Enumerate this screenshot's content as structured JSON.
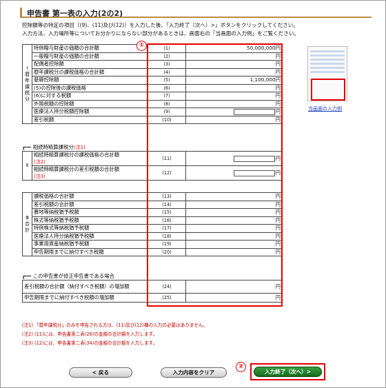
{
  "header": {
    "title": "申告書 第一表の入力(2の2)"
  },
  "instructions": [
    "控除額等の特定の項目（(9)、(11)及び(12)）を入力した後、「入力終了（次へ）>」ボタンをクリックしてください。",
    "入力方法、入力場所等についてお分かりにならない部分があるときは、画面右の「当画面の入力例」をご覧ください。"
  ],
  "annotations": {
    "marker1": "①",
    "marker2": "②"
  },
  "section1": {
    "category": [
      "Ⅰ",
      "暦",
      "年",
      "課",
      "税",
      "分"
    ],
    "rows": [
      {
        "label": "特例贈与財産の価額の合計額",
        "num": "(1)",
        "value": "50,000,000",
        "unit": "円",
        "input": false
      },
      {
        "label": "一般贈与財産の価額の合計額",
        "num": "(2)",
        "value": "",
        "unit": "円",
        "input": false
      },
      {
        "label": "配偶者控除額",
        "num": "(3)",
        "value": "",
        "unit": "円",
        "input": false
      },
      {
        "label": "暦年課税分の課税価格の合計額",
        "num": "(4)",
        "value": "",
        "unit": "円",
        "input": false
      },
      {
        "label": "基礎控除額",
        "num": "(5)",
        "value": "1,100,000",
        "unit": "円",
        "input": false
      },
      {
        "label": "(5)の控除後の課税価格",
        "num": "(6)",
        "value": "",
        "unit": "円",
        "input": false
      },
      {
        "label": "(6)に対する税額",
        "num": "(7)",
        "value": "",
        "unit": "円",
        "input": false
      },
      {
        "label": "外国税額の控除額",
        "num": "(8)",
        "value": "",
        "unit": "円",
        "input": false
      },
      {
        "label": "医療法人持分税額控除額",
        "num": "(9)",
        "value": "",
        "unit": "円",
        "input": true
      },
      {
        "label": "差引税額",
        "num": "(10)",
        "value": "",
        "unit": "円",
        "input": false
      }
    ]
  },
  "section2": {
    "heading": "相続時精算課税分",
    "heading_note": "(注1)",
    "category": "Ⅱ",
    "rows": [
      {
        "label": "相続時精算課税分の課税価格の合計額",
        "note": "(注2)",
        "num": "(11)",
        "unit": "円"
      },
      {
        "label": "相続時精算課税分の差引税額の合計額",
        "note": "(注3)",
        "num": "(12)",
        "unit": "円"
      }
    ]
  },
  "section3": {
    "category": [
      "Ⅲ",
      "合",
      "計"
    ],
    "rows": [
      {
        "label": "課税価格の合計額",
        "num": "(13)",
        "unit": "円"
      },
      {
        "label": "差引税額の合計額",
        "num": "(14)",
        "unit": "円"
      },
      {
        "label": "農地等納税猶予税額",
        "num": "(15)",
        "unit": "円"
      },
      {
        "label": "株式等納税猶予税額",
        "num": "(16)",
        "unit": "円"
      },
      {
        "label": "特例株式等納税猶予税額",
        "num": "(17)",
        "unit": "円"
      },
      {
        "label": "医療法人持分納税猶予税額",
        "num": "(18)",
        "unit": "円"
      },
      {
        "label": "事業用資産納税猶予税額",
        "num": "(19)",
        "unit": "円"
      },
      {
        "label": "申告期限までに納付すべき税額",
        "num": "(20)",
        "unit": "円"
      }
    ]
  },
  "section4": {
    "heading": "この申告書が修正申告書である場合",
    "rows": [
      {
        "label": "差引税額の合計額（納付すべき税額）の増加額",
        "num": "(24)",
        "unit": "円"
      },
      {
        "label": "申告期限までに納付すべき税額の増加額",
        "num": "(25)",
        "unit": "円"
      }
    ]
  },
  "example": {
    "link_label": "当画面の入力例"
  },
  "notes": [
    "(注1) 「暦年課税分」のみを申告される方は、(11)及び(12)欄の入力の必要はありません。",
    "(注2) (11)には、申告書第二表(26)の金額の合計額を入力します。",
    "(注3) (12)には、申告書第二表(34)の金額の合計額を入力します。"
  ],
  "buttons": {
    "back": "< 戻る",
    "clear": "入力内容をクリア",
    "next": "入力終了（次へ）>"
  },
  "colors": {
    "accent_red": "#e10000",
    "next_green": "#1f7a27",
    "title_rule": "#b98a45"
  }
}
